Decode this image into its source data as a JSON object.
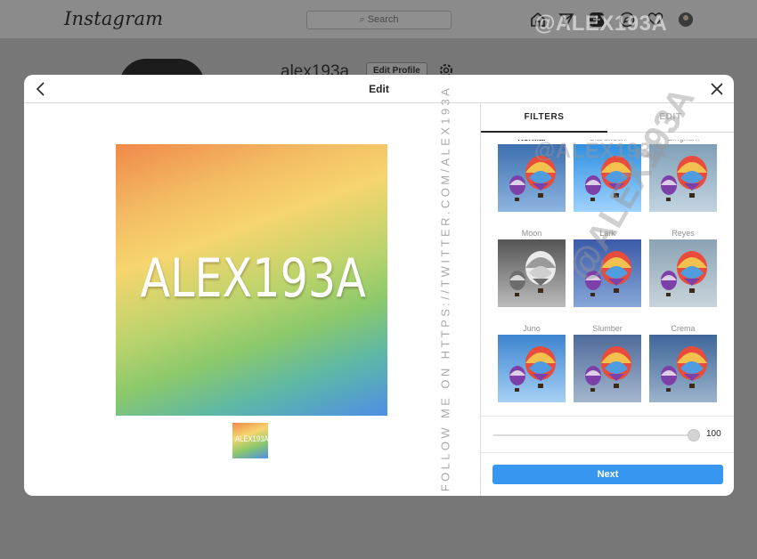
{
  "app": {
    "brand": "Instagram",
    "search_placeholder": "Search",
    "profile_username": "alex193a",
    "edit_profile_label": "Edit Profile"
  },
  "modal": {
    "title": "Edit",
    "tabs": [
      {
        "label": "FILTERS",
        "active": true
      },
      {
        "label": "EDIT",
        "active": false
      }
    ],
    "image_text": "ALEX193A",
    "thumbnail_text": "ALEX193A",
    "vertical_note": "FOLLOW ME ON HTTPS://TWITTER.COM/ALEX193A",
    "filters": [
      {
        "name": "Normal",
        "active": true,
        "tone": "normal"
      },
      {
        "name": "Clarendon",
        "active": false,
        "tone": "clarendon"
      },
      {
        "name": "Gingham",
        "active": false,
        "tone": "gingham"
      },
      {
        "name": "Moon",
        "active": false,
        "tone": "moon"
      },
      {
        "name": "Lark",
        "active": false,
        "tone": "lark"
      },
      {
        "name": "Reyes",
        "active": false,
        "tone": "reyes"
      },
      {
        "name": "Juno",
        "active": false,
        "tone": "juno"
      },
      {
        "name": "Slumber",
        "active": false,
        "tone": "slumber"
      },
      {
        "name": "Crema",
        "active": false,
        "tone": "crema"
      }
    ],
    "slider_value": "100",
    "next_label": "Next"
  },
  "watermarks": {
    "top": "@ALEX193A",
    "middle": "@ALEX193A",
    "diagonal": "@ALEX193A"
  },
  "colors": {
    "accent": "#3797f0",
    "active_text": "#262626",
    "inactive_text": "#8e8e8e"
  }
}
